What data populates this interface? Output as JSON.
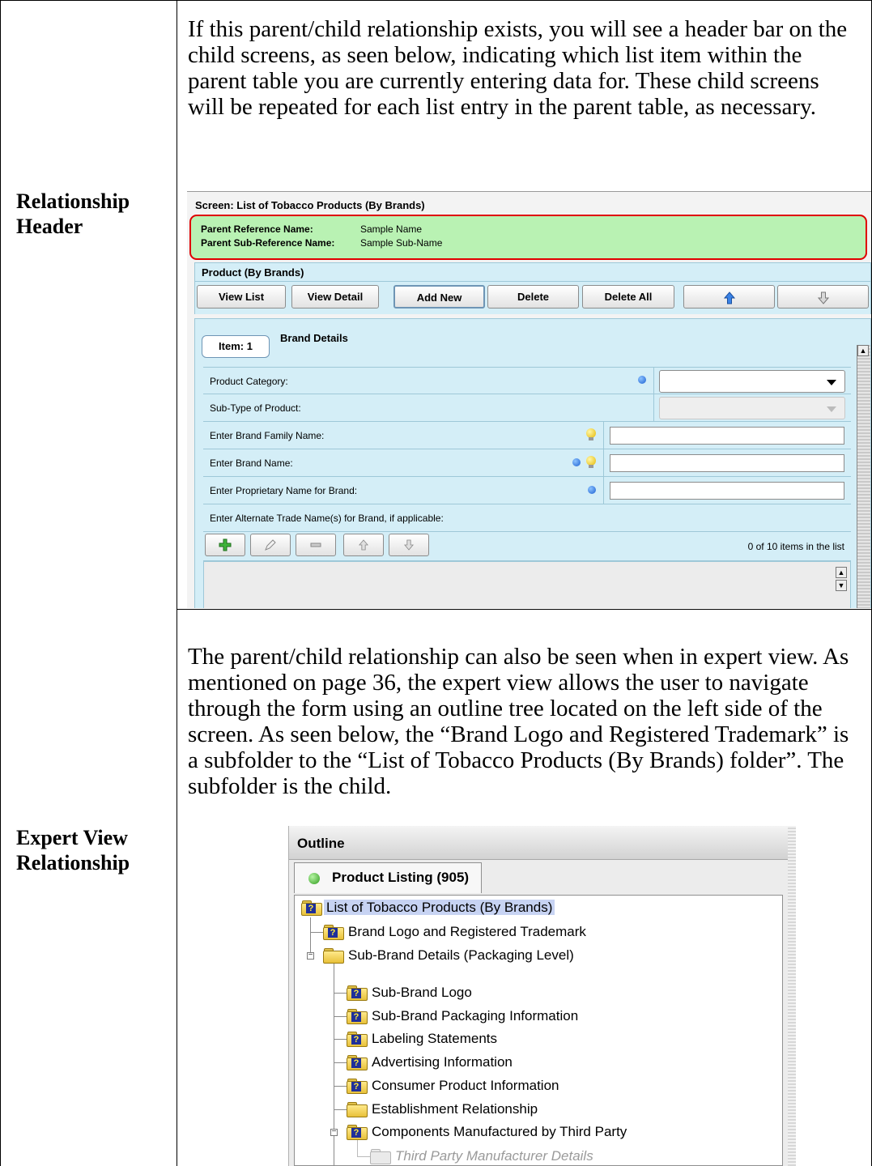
{
  "rows": [
    {
      "label": "Relationship\nHeader",
      "paragraph": "If this parent/child relationship exists, you will see a header bar on the child screens, as seen below, indicating which list item within the parent table you are currently entering data for. These child screens will be repeated for each list entry in the parent table, as necessary."
    },
    {
      "label": "Expert View\nRelationship",
      "paragraph": "The parent/child relationship can also be seen when in expert view. As mentioned on page 36, the expert view allows the user to navigate through the form using an outline tree located on the left side of the screen.  As seen below, the “Brand Logo and Registered Trademark” is a subfolder to the “List of Tobacco Products (By Brands) folder”.  The subfolder is the child."
    }
  ],
  "screen1": {
    "title": "Screen: List of Tobacco Products (By Brands)",
    "header": {
      "parent_ref_label": "Parent Reference Name:",
      "parent_ref_value": "Sample Name",
      "parent_sub_label": "Parent Sub-Reference Name:",
      "parent_sub_value": "Sample Sub-Name",
      "highlight_color": "#e00000",
      "background": "#b9f2b3"
    },
    "panel_title": "Product (By Brands)",
    "buttons": [
      "View List",
      "View Detail",
      "Add New",
      "Delete",
      "Delete All"
    ],
    "up_arrow_icon": "arrow-up-icon",
    "down_arrow_icon": "arrow-down-icon",
    "item_tab": "Item: 1",
    "section_title": "Brand Details",
    "fields": [
      {
        "label": "Product Category:",
        "indicators": [
          "required-dot-icon"
        ],
        "control": "dropdown"
      },
      {
        "label": "Sub-Type of Product:",
        "indicators": [],
        "control": "dropdown-disabled"
      },
      {
        "label": "Enter Brand Family Name:",
        "indicators": [
          "hint-bulb-icon"
        ],
        "control": "text"
      },
      {
        "label": "Enter Brand Name:",
        "indicators": [
          "required-dot-icon",
          "hint-bulb-icon"
        ],
        "control": "text"
      },
      {
        "label": "Enter Proprietary Name for Brand:",
        "indicators": [
          "required-dot-icon"
        ],
        "control": "text"
      },
      {
        "label": "Enter Alternate Trade Name(s) for Brand, if applicable:",
        "indicators": [],
        "control": "list"
      }
    ],
    "list_count": "0 of 10 items in the list",
    "accent_color": "#d4eef7"
  },
  "screen2": {
    "title": "Outline",
    "tab_label": "Product Listing (905)",
    "tree": [
      {
        "label": "List of Tobacco Products (By Brands)",
        "selected": true
      },
      {
        "label": "Brand Logo and Registered Trademark"
      },
      {
        "label": "Sub-Brand Details (Packaging Level)"
      },
      {
        "label": "Sub-Brand Logo"
      },
      {
        "label": "Sub-Brand Packaging Information"
      },
      {
        "label": "Labeling Statements"
      },
      {
        "label": "Advertising Information"
      },
      {
        "label": "Consumer Product Information"
      },
      {
        "label": "Establishment Relationship"
      },
      {
        "label": "Components Manufactured by Third Party"
      },
      {
        "label": "Third Party Manufacturer Details",
        "disabled": true
      }
    ]
  }
}
